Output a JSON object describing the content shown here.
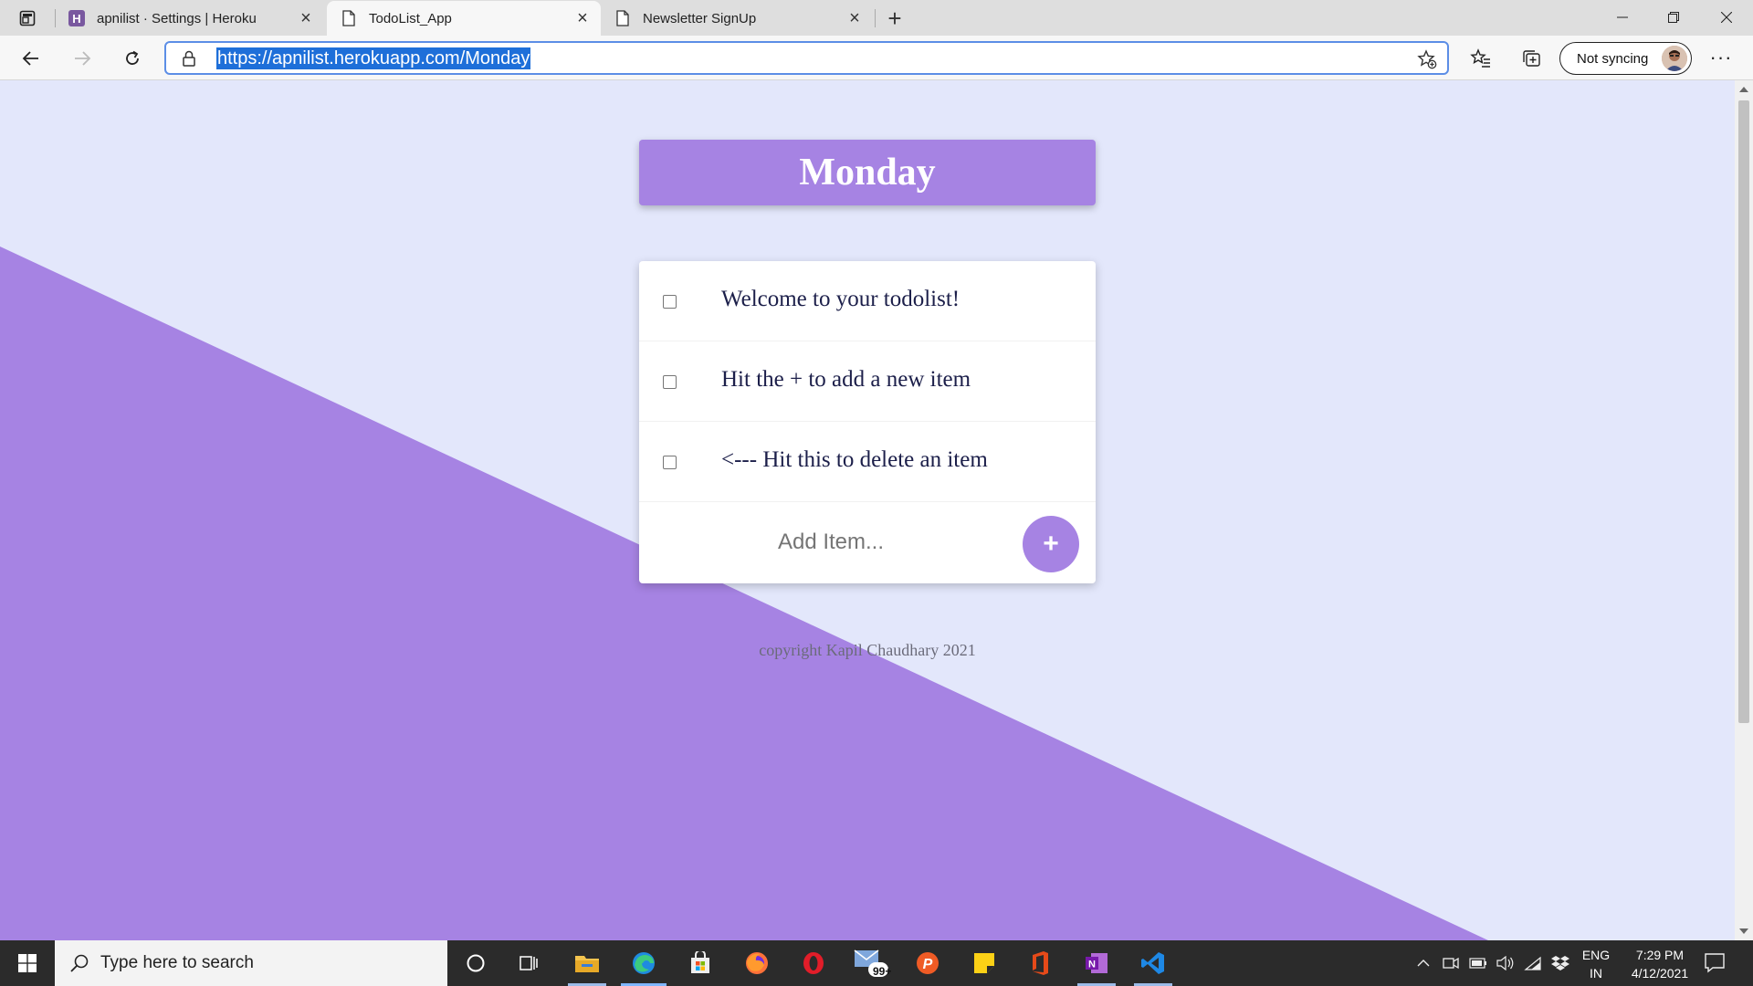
{
  "browser": {
    "tabs": [
      {
        "title": "apnilist · Settings | Heroku",
        "icon": "heroku-icon",
        "active": false
      },
      {
        "title": "TodoList_App",
        "icon": "page-icon",
        "active": true
      },
      {
        "title": "Newsletter SignUp",
        "icon": "page-icon",
        "active": false
      }
    ],
    "url": "https://apnilist.herokuapp.com/Monday",
    "sync_label": "Not syncing"
  },
  "page": {
    "heading": "Monday",
    "items": [
      {
        "text": "Welcome to your todolist!",
        "checked": false
      },
      {
        "text": "Hit the + to add a new item",
        "checked": false
      },
      {
        "text": "<--- Hit this to delete an item",
        "checked": false
      }
    ],
    "add_placeholder": "Add Item...",
    "add_button_label": "+",
    "footer": "copyright Kapil Chaudhary 2021",
    "colors": {
      "accent": "#a683e3",
      "background": "#e3e7fb",
      "text": "#1c1f4a"
    }
  },
  "taskbar": {
    "search_placeholder": "Type here to search",
    "mail_badge": "99+",
    "language": {
      "line1": "ENG",
      "line2": "IN"
    },
    "clock": {
      "time": "7:29 PM",
      "date": "4/12/2021"
    },
    "apps": [
      "cortana-icon",
      "task-view-icon",
      "file-explorer-icon",
      "edge-icon",
      "store-icon",
      "firefox-icon",
      "opera-icon",
      "mail-icon",
      "postman-icon",
      "sticky-notes-icon",
      "office-icon",
      "onenote-icon",
      "vscode-icon"
    ]
  }
}
